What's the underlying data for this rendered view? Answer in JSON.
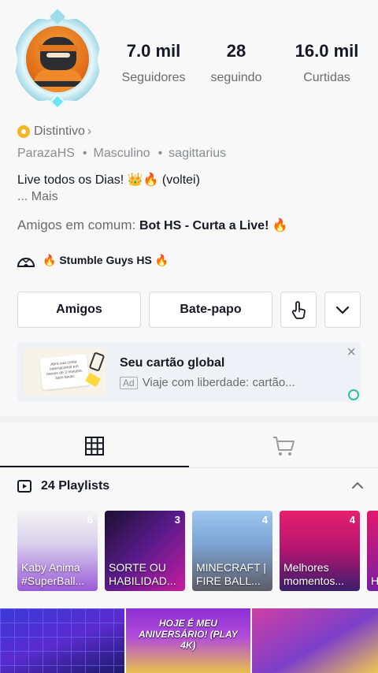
{
  "profile": {
    "stats": [
      {
        "value": "7.0 mil",
        "label": "Seguidores"
      },
      {
        "value": "28",
        "label": "seguindo"
      },
      {
        "value": "16.0 mil",
        "label": "Curtidas"
      }
    ],
    "badge_label": "Distintivo",
    "username": "ParazaHS",
    "gender": "Masculino",
    "sign": "sagittarius",
    "bio_line1": "Live todos os Dias! 👑🔥 (voltei)",
    "bio_more_prefix": "... ",
    "bio_more": "Mais",
    "friends_prefix": "Amigos em comum: ",
    "friends_names": "Bot HS - Curta a Live! 🔥",
    "live_label": "🔥 Stumble Guys HS 🔥"
  },
  "buttons": {
    "friends": "Amigos",
    "chat": "Bate-papo"
  },
  "ad": {
    "title": "Seu cartão global",
    "tag": "Ad",
    "subtitle": "Viaje com liberdade: cartão...",
    "thumb_text": "Abra sua conta internacional em menos de 3 minutos. Sem taxas."
  },
  "playlists": {
    "header": "24 Playlists",
    "items": [
      {
        "title": "Kaby Anima #SuperBall...",
        "count": "6"
      },
      {
        "title": "SORTE OU HABILIDAD...",
        "count": "3"
      },
      {
        "title": "MINECRAFT | FIRE BALL...",
        "count": "4"
      },
      {
        "title": "Melhores momentos...",
        "count": "4"
      },
      {
        "title": "H #",
        "count": ""
      }
    ]
  },
  "videos": {
    "v2_caption": "HOJE É MEU ANIVERSÁRIO! (PLAY 4K)"
  }
}
